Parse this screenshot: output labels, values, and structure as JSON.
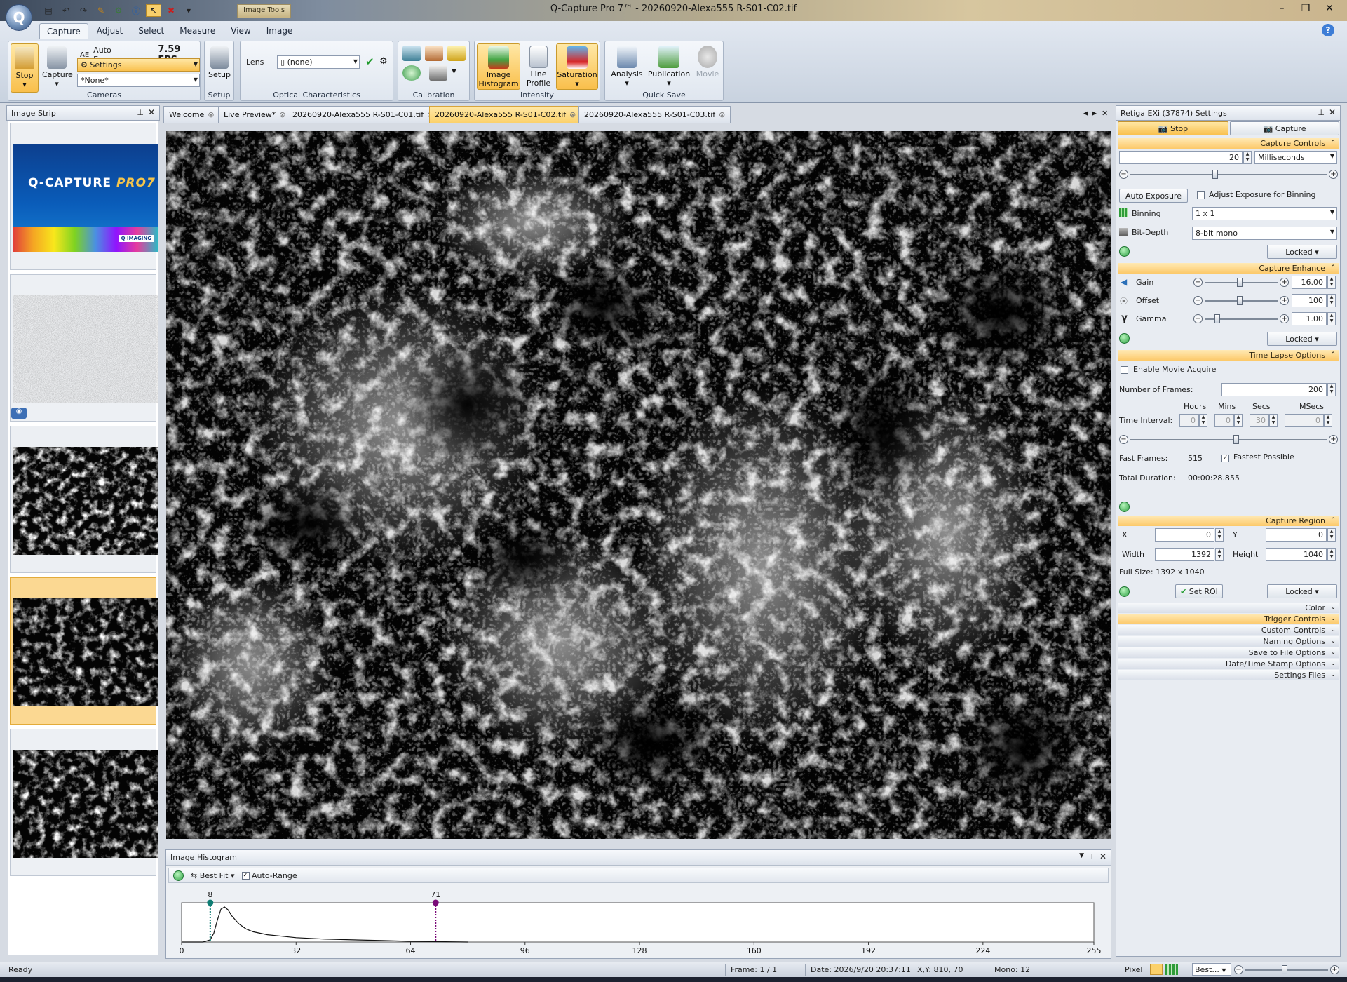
{
  "window": {
    "title": "Q-Capture Pro 7™ - 20260920-Alexa555 R-S01-C02.tif",
    "contextual_tab": "Image Tools",
    "controls": [
      "minimize",
      "restore",
      "close"
    ]
  },
  "ribbon": {
    "tabs": [
      "Capture",
      "Adjust",
      "Select",
      "Measure",
      "View",
      "Image"
    ],
    "active_tab": "Capture",
    "cameras": {
      "caption": "Cameras",
      "stop_label": "Stop",
      "capture_label": "Capture",
      "auto_exposure_label": "Auto Exposure",
      "fps": "7.59 FPS",
      "settings_label": "Settings",
      "settings_selected": "*None*"
    },
    "setup": {
      "caption": "Setup",
      "button_label": "Setup"
    },
    "optical": {
      "caption": "Optical Characteristics",
      "lens_label": "Lens",
      "lens_value": "(none)"
    },
    "calibration": {
      "caption": "Calibration"
    },
    "intensity": {
      "caption": "Intensity",
      "histogram_label": "Image Histogram",
      "line_profile_label": "Line Profile",
      "saturation_label": "Saturation"
    },
    "quicksave": {
      "caption": "Quick Save",
      "analysis_label": "Analysis",
      "publication_label": "Publication",
      "movie_label": "Movie"
    }
  },
  "image_strip": {
    "title": "Image Strip",
    "splash": {
      "brand": "Q-CAPTURE",
      "suffix": "PRO7",
      "tagline": "Q IMAGING"
    }
  },
  "doc_tabs": [
    {
      "label": "Welcome",
      "active": false
    },
    {
      "label": "Live Preview*",
      "active": false
    },
    {
      "label": "20260920-Alexa555 R-S01-C01.tif",
      "active": false
    },
    {
      "label": "20260920-Alexa555 R-S01-C02.tif",
      "active": true
    },
    {
      "label": "20260920-Alexa555 R-S01-C03.tif",
      "active": false
    }
  ],
  "histogram": {
    "title": "Image Histogram",
    "best_fit_label": "Best Fit",
    "auto_range_label": "Auto-Range",
    "auto_range_checked": true,
    "low_marker": 8,
    "high_marker": 71,
    "axis_ticks": [
      "0",
      "32",
      "64",
      "96",
      "128",
      "160",
      "192",
      "224",
      "255"
    ]
  },
  "chart_data": {
    "type": "area",
    "title": "",
    "xlim": [
      0,
      255
    ],
    "xticks": [
      0,
      32,
      64,
      96,
      128,
      160,
      192,
      224,
      255
    ],
    "x": [
      0,
      6,
      8,
      9,
      10,
      11,
      12,
      13,
      14,
      16,
      18,
      20,
      24,
      28,
      32,
      40,
      48,
      56,
      64,
      72,
      80
    ],
    "y": [
      0,
      0,
      3,
      12,
      30,
      45,
      48,
      44,
      36,
      25,
      18,
      14,
      10,
      8,
      6,
      4,
      3,
      2,
      1,
      0.5,
      0
    ],
    "markers": [
      {
        "label": "8",
        "x": 8,
        "color": "#0f7d74"
      },
      {
        "label": "71",
        "x": 71,
        "color": "#7a0a78"
      }
    ]
  },
  "settings": {
    "title": "Retiga EXi (37874) Settings",
    "stop_label": "Stop",
    "capture_label": "Capture",
    "capture_controls": {
      "header": "Capture Controls",
      "exposure_value": "20",
      "exposure_unit": "Milliseconds",
      "auto_exposure_label": "Auto Exposure",
      "adjust_binning_label": "Adjust Exposure for Binning",
      "binning_label": "Binning",
      "binning_value": "1 x 1",
      "bitdepth_label": "Bit-Depth",
      "bitdepth_value": "8-bit mono",
      "locked_label": "Locked"
    },
    "capture_enhance": {
      "header": "Capture Enhance",
      "gain_label": "Gain",
      "gain_value": "16.00",
      "offset_label": "Offset",
      "offset_value": "100",
      "gamma_label": "Gamma",
      "gamma_value": "1.00",
      "locked_label": "Locked"
    },
    "time_lapse": {
      "header": "Time Lapse Options",
      "enable_movie_label": "Enable Movie Acquire",
      "frames_label": "Number of Frames:",
      "frames_value": "200",
      "col_hours": "Hours",
      "col_mins": "Mins",
      "col_secs": "Secs",
      "col_msecs": "MSecs",
      "interval_label": "Time Interval:",
      "hours": "0",
      "mins": "0",
      "secs": "30",
      "msecs": "0",
      "fast_frames_label": "Fast Frames:",
      "fast_frames_value": "515",
      "fastest_label": "Fastest Possible",
      "total_label": "Total Duration:",
      "total_value": "00:00:28.855"
    },
    "capture_region": {
      "header": "Capture Region",
      "x_label": "X",
      "x_value": "0",
      "y_label": "Y",
      "y_value": "0",
      "width_label": "Width",
      "width_value": "1392",
      "height_label": "Height",
      "height_value": "1040",
      "full_size": "Full Size: 1392 x 1040",
      "set_roi_label": "Set ROI",
      "locked_label": "Locked"
    },
    "collapsed_sections": [
      "Color",
      "Trigger Controls",
      "Custom Controls",
      "Naming Options",
      "Save to File Options",
      "Date/Time Stamp Options",
      "Settings Files"
    ]
  },
  "status": {
    "ready": "Ready",
    "frame": "Frame: 1 / 1",
    "date": "Date: 2026/9/20 20:37:11",
    "xy": "X,Y:  810,   70",
    "mono": "Mono:   12",
    "pixel": "Pixel",
    "zoom": "Best..."
  },
  "colors": {
    "accent": "#fbc85e",
    "ribbon": "#dfe6ef",
    "low_marker": "#0f7d74",
    "high_marker": "#7a0a78"
  }
}
